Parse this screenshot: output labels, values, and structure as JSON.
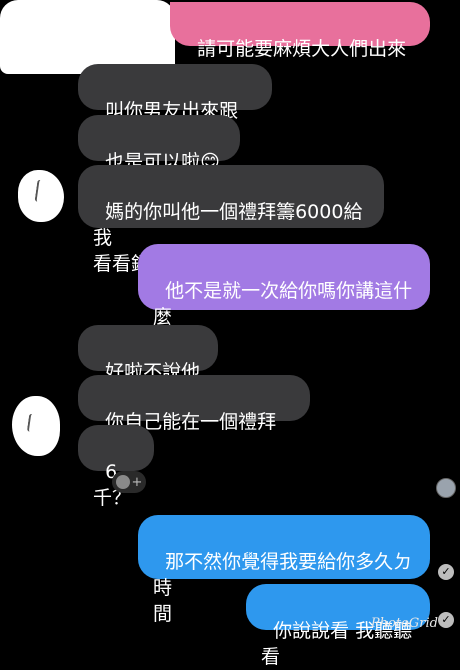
{
  "messages": {
    "m1": "請可能要麻煩大人們出來處理",
    "m2": "叫你男友出來跟我講",
    "m3": "也是可以啦😊😊",
    "m4": "媽的你叫他一個禮拜籌6000給我\n看看銅😊",
    "m5": "他不是就一次給你嗎你講這什麼\n屁話",
    "m6": "好啦不說他啦",
    "m7": "你自己能在一個禮拜籌出",
    "m8": "6千？",
    "m9": "那不然你覺得我要給你多久ㄉ時\n間",
    "m10": "你說說看 我聽聽看"
  },
  "icons": {
    "reaction": "smiley-plus-icon",
    "read_receipt": "check-circle-icon"
  },
  "reaction_plus": "+",
  "check_mark": "✓",
  "watermark": "PhotoGrid",
  "colors": {
    "background": "#000000",
    "incoming": "#3a3a3c",
    "pink": "#e8709c",
    "purple": "#a27ae4",
    "blue": "#2e98ee"
  }
}
